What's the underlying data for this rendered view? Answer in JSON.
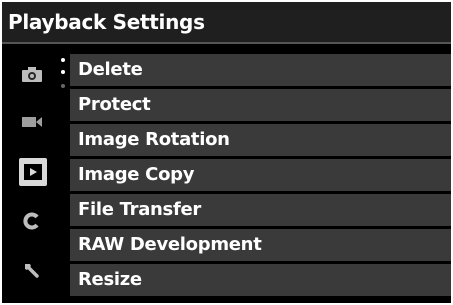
{
  "header": {
    "title": "Playback Settings"
  },
  "sidebar": {
    "tabs": [
      {
        "icon": "camera-icon"
      },
      {
        "icon": "video-camera-icon"
      },
      {
        "icon": "playback-icon",
        "active": true
      },
      {
        "icon": "c-custom-icon"
      },
      {
        "icon": "wrench-icon"
      }
    ]
  },
  "menu": {
    "items": [
      {
        "label": "Delete"
      },
      {
        "label": "Protect"
      },
      {
        "label": "Image Rotation"
      },
      {
        "label": "Image Copy"
      },
      {
        "label": "File Transfer"
      },
      {
        "label": "RAW Development"
      },
      {
        "label": "Resize"
      }
    ]
  },
  "colors": {
    "background": "#000000",
    "item_background": "#3a3a3a",
    "active_tab": "#d9d9d9",
    "text": "#ffffff"
  }
}
